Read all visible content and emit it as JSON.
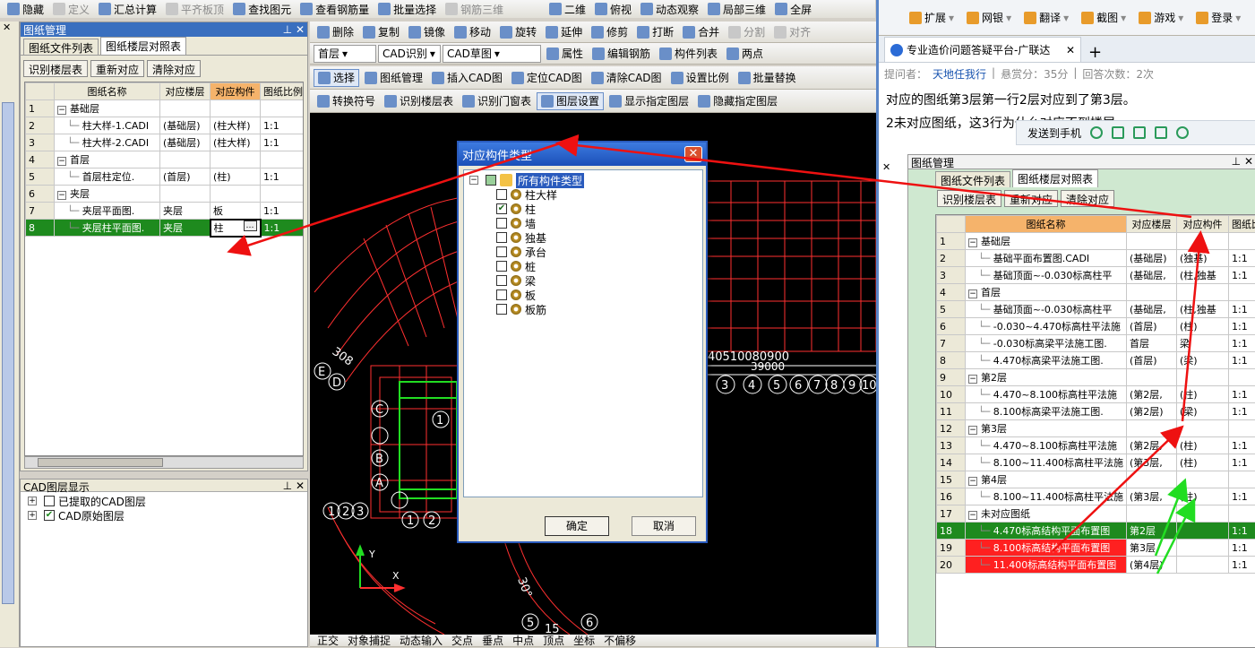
{
  "left_toolbar": [
    {
      "label": "隐藏",
      "icon": "eye-icon",
      "enabled": true
    },
    {
      "label": "定义",
      "icon": "define-icon",
      "enabled": false
    },
    {
      "label": "汇总计算",
      "icon": "sum-icon",
      "enabled": true
    },
    {
      "label": "平齐板顶",
      "icon": "level-icon",
      "enabled": false
    },
    {
      "label": "查找图元",
      "icon": "binoculars-icon",
      "enabled": true
    },
    {
      "label": "查看钢筋量",
      "icon": "rebar-view-icon",
      "enabled": true
    },
    {
      "label": "批量选择",
      "icon": "batch-icon",
      "enabled": true
    },
    {
      "label": "钢筋三维",
      "icon": "rebar3d-icon",
      "enabled": false
    }
  ],
  "view_toolbar": [
    {
      "label": "二维"
    },
    {
      "label": "俯视"
    },
    {
      "label": "动态观察"
    },
    {
      "label": "局部三维"
    },
    {
      "label": "全屏"
    }
  ],
  "edit_toolbar": [
    "删除",
    "复制",
    "镜像",
    "移动",
    "旋转",
    "延伸",
    "修剪",
    "打断",
    "合并",
    "分割",
    "对齐"
  ],
  "cad_toolbar": {
    "floor": "首层",
    "mode": "CAD识别",
    "draft": "CAD草图",
    "items": [
      "属性",
      "编辑钢筋",
      "构件列表",
      "两点"
    ]
  },
  "cad_toolbar2": [
    "选择",
    "图纸管理",
    "插入CAD图",
    "定位CAD图",
    "清除CAD图",
    "设置比例",
    "批量替换"
  ],
  "cad_toolbar3": [
    "转换符号",
    "识别楼层表",
    "识别门窗表",
    "图层设置",
    "显示指定图层",
    "隐藏指定图层"
  ],
  "drawing_panel": {
    "title": "图纸管理",
    "tabs": [
      "图纸文件列表",
      "图纸楼层对照表"
    ],
    "buttons": [
      "识别楼层表",
      "重新对应",
      "清除对应"
    ],
    "headers": [
      "图纸名称",
      "对应楼层",
      "对应构件",
      "图纸比例"
    ],
    "rows": [
      {
        "n": "1",
        "name": "基础层",
        "floor": "",
        "comp": "",
        "scale": "",
        "group": true
      },
      {
        "n": "2",
        "name": "柱大样-1.CADI",
        "floor": "(基础层)",
        "comp": "(柱大样)",
        "scale": "1:1"
      },
      {
        "n": "3",
        "name": "柱大样-2.CADI",
        "floor": "(基础层)",
        "comp": "(柱大样)",
        "scale": "1:1"
      },
      {
        "n": "4",
        "name": "首层",
        "floor": "",
        "comp": "",
        "scale": "",
        "group": true
      },
      {
        "n": "5",
        "name": "首层柱定位.",
        "floor": "(首层)",
        "comp": "(柱)",
        "scale": "1:1"
      },
      {
        "n": "6",
        "name": "夹层",
        "floor": "",
        "comp": "",
        "scale": "",
        "group": true
      },
      {
        "n": "7",
        "name": "夹层平面图.",
        "floor": "夹层",
        "comp": "板",
        "scale": "1:1"
      },
      {
        "n": "8",
        "name": "夹层柱平面图.",
        "floor": "夹层",
        "comp": "柱",
        "scale": "1:1",
        "selected": true
      }
    ]
  },
  "layer_panel": {
    "title": "CAD图层显示",
    "items": [
      {
        "label": "已提取的CAD图层",
        "checked": false
      },
      {
        "label": "CAD原始图层",
        "checked": true
      }
    ]
  },
  "dialog": {
    "title": "对应构件类型",
    "root": "所有构件类型",
    "items": [
      {
        "label": "柱大样",
        "checked": false
      },
      {
        "label": "柱",
        "checked": true
      },
      {
        "label": "墙",
        "checked": false
      },
      {
        "label": "独基",
        "checked": false
      },
      {
        "label": "承台",
        "checked": false
      },
      {
        "label": "桩",
        "checked": false
      },
      {
        "label": "梁",
        "checked": false
      },
      {
        "label": "板",
        "checked": false
      },
      {
        "label": "板筋",
        "checked": false
      }
    ],
    "ok": "确定",
    "cancel": "取消"
  },
  "cad_labels": {
    "dims": "40510080900",
    "dims2": "39000",
    "axis_nums": [
      "3",
      "4",
      "5",
      "6",
      "7",
      "8",
      "9",
      "10"
    ],
    "row_letters": [
      "E",
      "D",
      "C",
      "B",
      "A"
    ],
    "bottom": [
      "5",
      "15",
      "6"
    ],
    "left_nums": [
      "1",
      "2",
      "3",
      "4",
      "5"
    ],
    "angle": "30°",
    "small": "308"
  },
  "status_bar": [
    "正交",
    "对象捕捉",
    "动态输入",
    "交点",
    "垂点",
    "中点",
    "顶点",
    "坐标",
    "不偏移"
  ],
  "browser": {
    "toolbar": [
      "扩展",
      "网银",
      "翻译",
      "截图",
      "游戏",
      "登录"
    ],
    "tab_title": "专业造价问题答疑平台-广联达",
    "meta": {
      "asker_label": "提问者：",
      "asker": "天地任我行",
      "reward": "悬赏分：35分",
      "answers": "回答次数：2次"
    },
    "line1": "对应的图纸第3层第一行2层对应到了第3层。",
    "line2": "2未对应图纸，这3行为什么对应不到楼层",
    "send": "发送到手机"
  },
  "right_panel": {
    "title": "图纸管理",
    "tabs": [
      "图纸文件列表",
      "图纸楼层对照表"
    ],
    "buttons": [
      "识别楼层表",
      "重新对应",
      "清除对应"
    ],
    "headers": [
      "图纸名称",
      "对应楼层",
      "对应构件",
      "图纸比例"
    ],
    "rows": [
      {
        "n": "1",
        "name": "基础层",
        "floor": "",
        "comp": "",
        "scale": "",
        "group": true
      },
      {
        "n": "2",
        "name": "基础平面布置图.CADI",
        "floor": "(基础层)",
        "comp": "(独基)",
        "scale": "1:1"
      },
      {
        "n": "3",
        "name": "基础顶面~-0.030标高柱平",
        "floor": "(基础层,",
        "comp": "(柱,独基",
        "scale": "1:1"
      },
      {
        "n": "4",
        "name": "首层",
        "floor": "",
        "comp": "",
        "scale": "",
        "group": true
      },
      {
        "n": "5",
        "name": "基础顶面~-0.030标高柱平",
        "floor": "(基础层,",
        "comp": "(柱,独基",
        "scale": "1:1"
      },
      {
        "n": "6",
        "name": "-0.030~4.470标高柱平法施",
        "floor": "(首层)",
        "comp": "(柱)",
        "scale": "1:1"
      },
      {
        "n": "7",
        "name": "-0.030标高梁平法施工图.",
        "floor": "首层",
        "comp": "梁",
        "scale": "1:1"
      },
      {
        "n": "8",
        "name": "4.470标高梁平法施工图.",
        "floor": "(首层)",
        "comp": "(梁)",
        "scale": "1:1"
      },
      {
        "n": "9",
        "name": "第2层",
        "floor": "",
        "comp": "",
        "scale": "",
        "group": true
      },
      {
        "n": "10",
        "name": "4.470~8.100标高柱平法施",
        "floor": "(第2层,",
        "comp": "(柱)",
        "scale": "1:1"
      },
      {
        "n": "11",
        "name": "8.100标高梁平法施工图.",
        "floor": "(第2层)",
        "comp": "(梁)",
        "scale": "1:1"
      },
      {
        "n": "12",
        "name": "第3层",
        "floor": "",
        "comp": "",
        "scale": "",
        "group": true
      },
      {
        "n": "13",
        "name": "4.470~8.100标高柱平法施",
        "floor": "(第2层,",
        "comp": "(柱)",
        "scale": "1:1"
      },
      {
        "n": "14",
        "name": "8.100~11.400标高柱平法施",
        "floor": "(第3层,",
        "comp": "(柱)",
        "scale": "1:1"
      },
      {
        "n": "15",
        "name": "第4层",
        "floor": "",
        "comp": "",
        "scale": "",
        "group": true
      },
      {
        "n": "16",
        "name": "8.100~11.400标高柱平法施",
        "floor": "(第3层,",
        "comp": "(柱)",
        "scale": "1:1"
      },
      {
        "n": "17",
        "name": "未对应图纸",
        "floor": "",
        "comp": "",
        "scale": "",
        "group": true
      },
      {
        "n": "18",
        "name": "4.470标高结构平面布置图",
        "floor": "第2层",
        "comp": "",
        "scale": "1:1",
        "hl": "green"
      },
      {
        "n": "19",
        "name": "8.100标高结构平面布置图",
        "floor": "第3层",
        "comp": "",
        "scale": "1:1",
        "hl": "red"
      },
      {
        "n": "20",
        "name": "11.400标高结构平面布置图",
        "floor": "(第4层)",
        "comp": "",
        "scale": "1:1",
        "hl": "red"
      }
    ]
  },
  "colors": {
    "panel_title": "#3a6fbf",
    "selected_green": "#1e8a1e",
    "highlight_red": "#ff2020",
    "annotation_red": "#ee1111",
    "annotation_green": "#22dd22",
    "cad_red": "#ff3030"
  }
}
